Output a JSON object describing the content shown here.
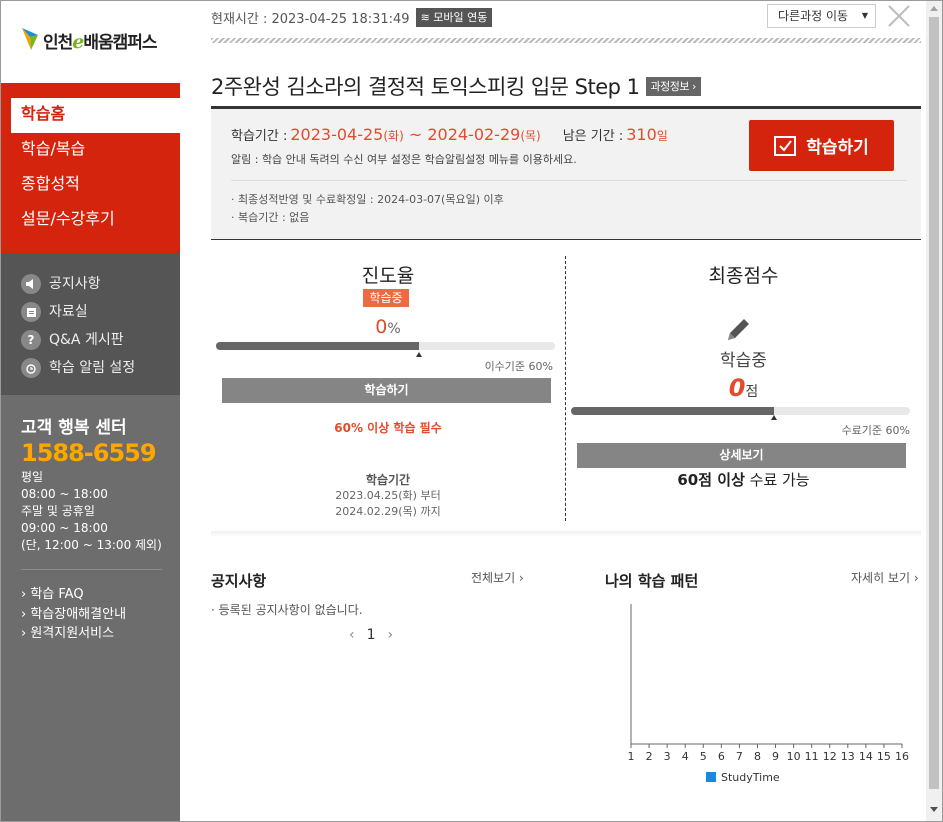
{
  "logo": {
    "text_prefix": "인천",
    "text_e": "e",
    "text_suffix": "배움캠퍼스"
  },
  "sidebar": {
    "main_menu": [
      "학습홈",
      "학습/복습",
      "종합성적",
      "설문/수강후기"
    ],
    "sub_menu": [
      {
        "label": "공지사항",
        "icon": "speaker-icon"
      },
      {
        "label": "자료실",
        "icon": "folder-icon"
      },
      {
        "label": "Q&A 게시판",
        "icon": "question-icon"
      },
      {
        "label": "학습 알림 설정",
        "icon": "alarm-clock-icon"
      }
    ],
    "support": {
      "title": "고객 행복 센터",
      "phone": "1588-6559",
      "hours": [
        "평일",
        "08:00 ~ 18:00",
        "주말 및 공휴일",
        "09:00 ~ 18:00",
        "(단, 12:00 ~ 13:00 제외)"
      ],
      "links": [
        "학습 FAQ",
        "학습장애해결안내",
        "원격지원서비스"
      ]
    }
  },
  "topbar": {
    "current_time_label": "현재시간 : 2023-04-25 18:31:49",
    "mobile_btn": "모바일 연동",
    "other_course_select": "다른과정 이동"
  },
  "course": {
    "title": "2주완성 김소라의 결정적 토익스피킹 입문 Step 1",
    "info_tag": "과정정보"
  },
  "info": {
    "period_label": "학습기간 :",
    "period_start": "2023-04-25",
    "period_start_day": "(화)",
    "period_sep": " ~ ",
    "period_end": "2024-02-29",
    "period_end_day": "(목)",
    "remain_label": "남은 기간 :",
    "remain_value": "310",
    "remain_unit": "일",
    "notice": "알림 : 학습 안내 독려의 수신 여부 설정은 학습알림설정 메뉴를 이용하세요.",
    "study_button": "학습하기",
    "meta": [
      "· 최종성적반영 및 수료확정일 : 2024-03-07(목요일) 이후",
      "· 복습기간 : 없음"
    ]
  },
  "progress": {
    "title": "진도율",
    "status": "학습중",
    "value": "0",
    "unit": "%",
    "fill_fraction": 0.6,
    "criteria": "이수기준 60%",
    "button": "학습하기",
    "must": "60% 이상 학습 필수",
    "period_head": "학습기간",
    "period_lines": [
      "2023.04.25(화) 부터",
      "2024.02.29(목) 까지"
    ]
  },
  "score": {
    "title": "최종점수",
    "status": "학습중",
    "value": "0",
    "unit": "점",
    "fill_fraction": 0.6,
    "criteria": "수료기준 60%",
    "button": "상세보기",
    "pass_bold": "60점 이상",
    "pass_rest": " 수료 가능"
  },
  "notices": {
    "title": "공지사항",
    "all_link": "전체보기 ›",
    "empty": "· 등록된 공지사항이 없습니다.",
    "page": "1"
  },
  "pattern": {
    "title": "나의 학습 패턴",
    "more_link": "자세히 보기 ›"
  },
  "chart_data": {
    "type": "bar",
    "categories": [
      "1",
      "2",
      "3",
      "4",
      "5",
      "6",
      "7",
      "8",
      "9",
      "10",
      "11",
      "12",
      "13",
      "14",
      "15",
      "16"
    ],
    "series": [
      {
        "name": "StudyTime",
        "values": [
          0,
          0,
          0,
          0,
          0,
          0,
          0,
          0,
          0,
          0,
          0,
          0,
          0,
          0,
          0,
          0
        ],
        "color": "#1f87d8"
      }
    ]
  }
}
